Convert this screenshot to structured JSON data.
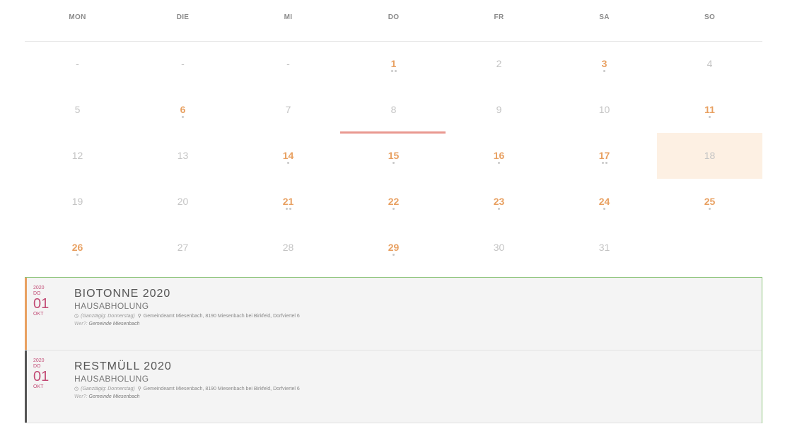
{
  "weekdays": [
    "MON",
    "DIE",
    "MI",
    "DO",
    "FR",
    "SA",
    "SO"
  ],
  "weeks": [
    [
      {
        "d": "-"
      },
      {
        "d": "-"
      },
      {
        "d": "-"
      },
      {
        "d": "1",
        "dots": 2
      },
      {
        "d": "2"
      },
      {
        "d": "3",
        "dots": 1
      },
      {
        "d": "4"
      }
    ],
    [
      {
        "d": "5"
      },
      {
        "d": "6",
        "dots": 1
      },
      {
        "d": "7"
      },
      {
        "d": "8"
      },
      {
        "d": "9"
      },
      {
        "d": "10"
      },
      {
        "d": "11",
        "dots": 1
      }
    ],
    [
      {
        "d": "12"
      },
      {
        "d": "13"
      },
      {
        "d": "14",
        "dots": 1
      },
      {
        "d": "15",
        "dots": 1
      },
      {
        "d": "16",
        "dots": 1
      },
      {
        "d": "17",
        "dots": 2
      },
      {
        "d": "18",
        "today": true
      }
    ],
    [
      {
        "d": "19"
      },
      {
        "d": "20"
      },
      {
        "d": "21",
        "dots": 2
      },
      {
        "d": "22",
        "dots": 1
      },
      {
        "d": "23",
        "dots": 1
      },
      {
        "d": "24",
        "dots": 1
      },
      {
        "d": "25",
        "dots": 1
      }
    ],
    [
      {
        "d": "26",
        "dots": 1
      },
      {
        "d": "27"
      },
      {
        "d": "28"
      },
      {
        "d": "29",
        "dots": 1
      },
      {
        "d": "30"
      },
      {
        "d": "31"
      },
      {
        "d": ""
      }
    ]
  ],
  "colors": {
    "event_day": "#e8a061",
    "today_bg": "#fdf0e3",
    "selection_line": "#e99890",
    "date_accent": "#c24b75"
  },
  "events": [
    {
      "year": "2020",
      "weekday": "DO",
      "day": "01",
      "month": "OKT",
      "title": "BIOTONNE 2020",
      "subtitle": "HAUSABHOLUNG",
      "time": "(Ganztägig: Donnerstag)",
      "location": "Gemeindeamt Miesenbach, 8190 Miesenbach bei Birkfeld, Dorfviertel 6",
      "who_label": "Wer?:",
      "who": "Gemeinde Miesenbach",
      "bar_color": "#e8a061"
    },
    {
      "year": "2020",
      "weekday": "DO",
      "day": "01",
      "month": "OKT",
      "title": "RESTMÜLL 2020",
      "subtitle": "HAUSABHOLUNG",
      "time": "(Ganztägig: Donnerstag)",
      "location": "Gemeindeamt Miesenbach, 8190 Miesenbach bei Birkfeld, Dorfviertel 6",
      "who_label": "Wer?:",
      "who": "Gemeinde Miesenbach",
      "bar_color": "#555555"
    }
  ]
}
